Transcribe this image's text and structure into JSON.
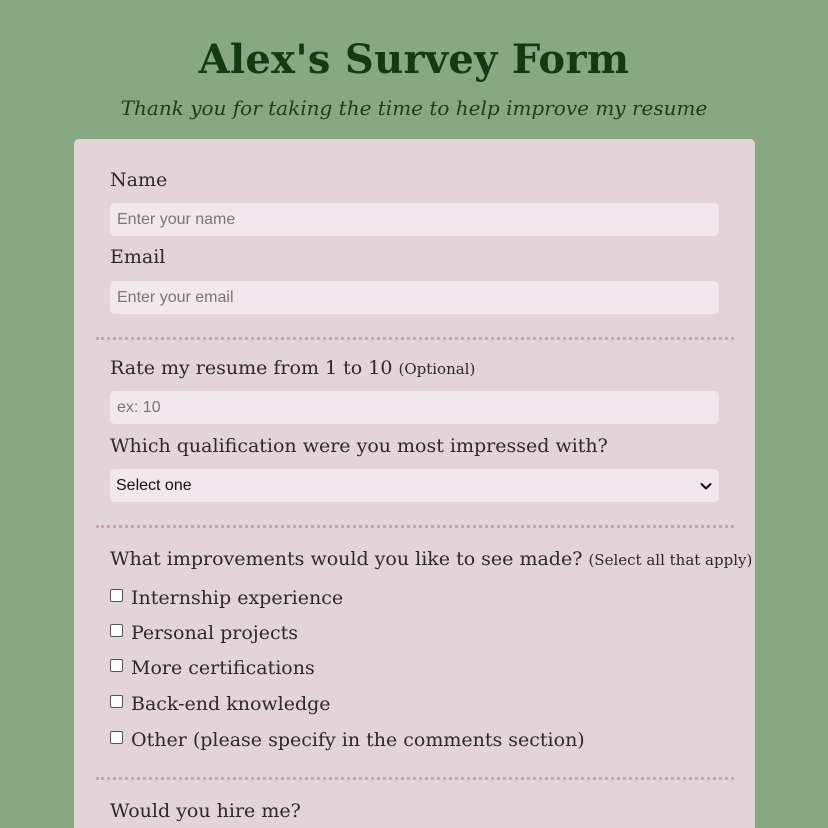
{
  "header": {
    "title": "Alex's Survey Form",
    "subtitle": "Thank you for taking the time to help improve my resume"
  },
  "form": {
    "name_label": "Name",
    "name_placeholder": "Enter your name",
    "email_label": "Email",
    "email_placeholder": "Enter your email",
    "rate_label": "Rate my resume from 1 to 10",
    "rate_hint": "(Optional)",
    "rate_placeholder": "ex: 10",
    "qualification_label": "Which qualification were you most impressed with?",
    "qualification_selected": "Select one",
    "improvements_label": "What improvements would you like to see made?",
    "improvements_hint": "(Select all that apply)",
    "improvements": [
      "Internship experience",
      "Personal projects",
      "More certifications",
      "Back-end knowledge",
      "Other (please specify in the comments section)"
    ],
    "hire_label": "Would you hire me?"
  },
  "colors": {
    "background": "#88a882",
    "card": "#e3d4da",
    "title": "#133a10",
    "input": "#f0e8ec",
    "divider": "#c9a3b1"
  },
  "icons": {
    "select_arrow": "chevron-down-icon"
  }
}
